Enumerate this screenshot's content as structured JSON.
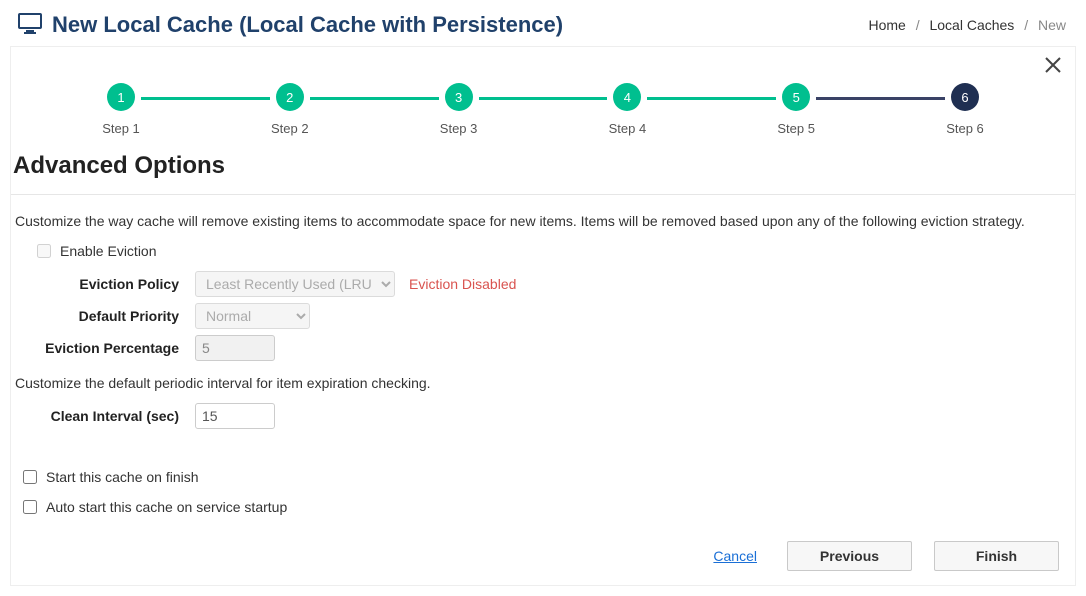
{
  "header": {
    "title": "New Local Cache (Local Cache with Persistence)"
  },
  "breadcrumb": {
    "home": "Home",
    "localCaches": "Local Caches",
    "new": "New"
  },
  "stepper": {
    "s1": {
      "num": "1",
      "label": "Step 1"
    },
    "s2": {
      "num": "2",
      "label": "Step 2"
    },
    "s3": {
      "num": "3",
      "label": "Step 3"
    },
    "s4": {
      "num": "4",
      "label": "Step 4"
    },
    "s5": {
      "num": "5",
      "label": "Step 5"
    },
    "s6": {
      "num": "6",
      "label": "Step 6"
    }
  },
  "section": {
    "title": "Advanced Options",
    "evictionDesc": "Customize the way cache will remove existing items to accommodate space for new items. Items will be removed based upon any of the following eviction strategy.",
    "enableEvictionLabel": "Enable Eviction",
    "policyLabel": "Eviction Policy",
    "policyValue": "Least Recently Used (LRU)",
    "policyWarn": "Eviction Disabled",
    "priorityLabel": "Default Priority",
    "priorityValue": "Normal",
    "percentLabel": "Eviction Percentage",
    "percentValue": "5",
    "intervalDesc": "Customize the default periodic interval for item expiration checking.",
    "intervalLabel": "Clean Interval (sec)",
    "intervalValue": "15",
    "startOnFinish": "Start this cache on finish",
    "autoStart": "Auto start this cache on service startup"
  },
  "footer": {
    "cancel": "Cancel",
    "previous": "Previous",
    "finish": "Finish"
  }
}
